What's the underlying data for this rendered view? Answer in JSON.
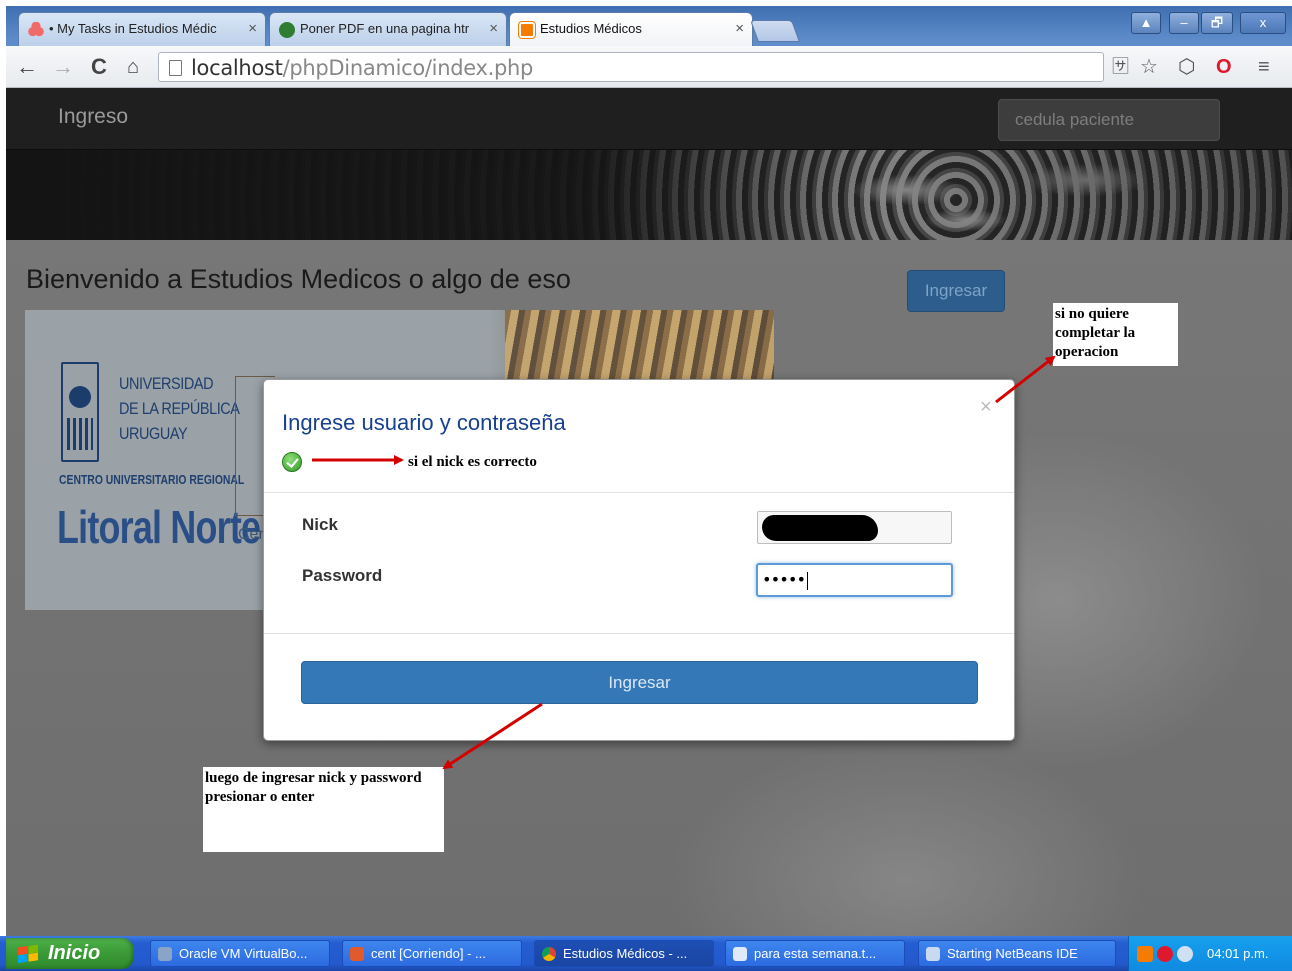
{
  "browser": {
    "tabs": [
      {
        "title": "• My Tasks in Estudios Médic",
        "active": false
      },
      {
        "title": "Poner PDF en una pagina htr",
        "active": false
      },
      {
        "title": "Estudios Médicos",
        "active": true
      }
    ],
    "tab_close_symbol": "×",
    "url_host": "localhost",
    "url_path": "/phpDinamico/index.php",
    "window_buttons": [
      "▲",
      "–",
      "🗗",
      "x"
    ]
  },
  "site": {
    "brand": "Ingreso",
    "cedula_placeholder": "cedula paciente",
    "welcome": "Bienvenido a Estudios Medicos o algo de eso",
    "top_button": "Ingresar",
    "banner": {
      "uni_lines": [
        "UNIVERSIDAD",
        "DE LA REPÚBLICA",
        "URUGUAY"
      ],
      "centro": "CENTRO UNIVERSITARIO REGIONAL",
      "litoral": "Litoral Norte",
      "cen": "Cen"
    }
  },
  "modal": {
    "title": "Ingrese usuario y contraseña",
    "close_symbol": "×",
    "nick_label": "Nick",
    "password_label": "Password",
    "password_mask": "•••••",
    "submit_label": "Ingresar"
  },
  "annotations": {
    "nick_correct": "si el nick es correcto",
    "cancel_note": "si no quiere completar la operacion",
    "enter_note": "luego de ingresar nick y password presionar o enter"
  },
  "taskbar": {
    "start_label": "Inicio",
    "tasks": [
      "Oracle VM VirtualBo...",
      "cent [Corriendo] - ...",
      "Estudios Médicos - ...",
      "para esta semana.t...",
      "Starting NetBeans IDE"
    ],
    "clock": "04:01 p.m."
  },
  "colors": {
    "navbar_bg": "#1f1f1f",
    "modal_title": "#17408f",
    "primary_button": "#3478b8",
    "annotation_arrow": "#d40000",
    "taskbar_blue": "#245ed1",
    "start_green": "#3a9a36"
  }
}
